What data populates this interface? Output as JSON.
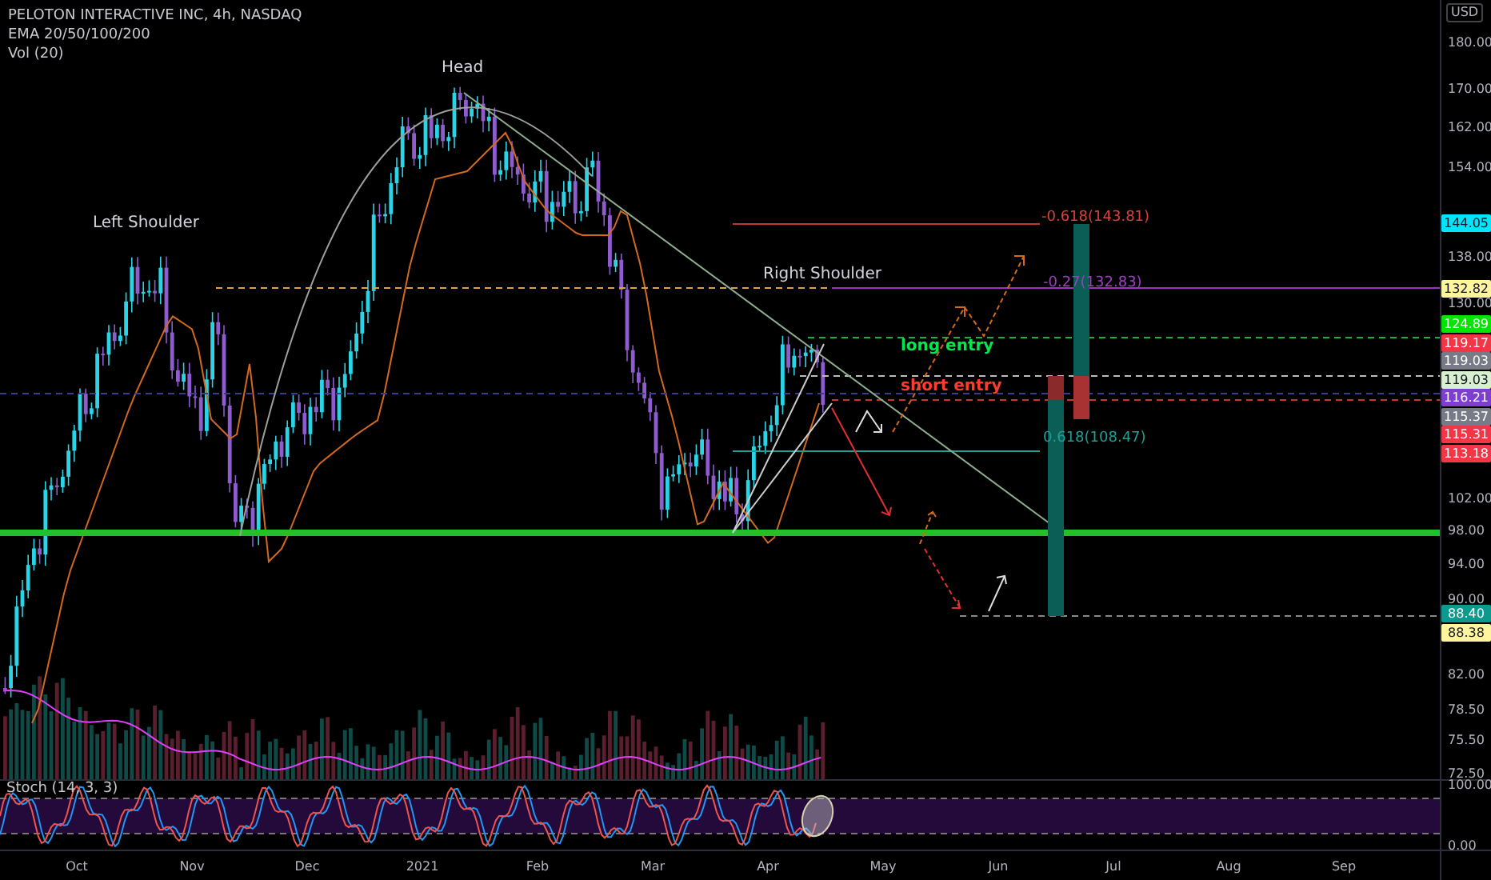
{
  "header": {
    "symbol": "PELOTON INTERACTIVE INC, 4h, NASDAQ",
    "indicators": [
      "EMA 20/50/100/200",
      "Vol (20)"
    ]
  },
  "annotations": [
    {
      "kind": "pattern",
      "text": "Head",
      "color": "#d1d4dc"
    },
    {
      "kind": "pattern",
      "text": "Left Shoulder",
      "color": "#d1d4dc"
    },
    {
      "kind": "pattern",
      "text": "Right Shoulder",
      "color": "#d1d4dc"
    },
    {
      "kind": "entry",
      "text": "long entry",
      "color": "#00e64d"
    },
    {
      "kind": "entry",
      "text": "short entry",
      "color": "#ff3b30"
    },
    {
      "kind": "fib",
      "text": "-0.618(143.81)",
      "color": "#d9413a"
    },
    {
      "kind": "fib",
      "text": "-0.27(132.83)",
      "color": "#9c3fc0"
    },
    {
      "kind": "fib",
      "text": "0.618(108.47)",
      "color": "#1f9e94"
    }
  ],
  "price_axis": {
    "currency": "USD",
    "ticks": [
      "180.00",
      "170.00",
      "162.00",
      "154.00",
      "138.00",
      "130.00",
      "102.00",
      "98.00",
      "94.00",
      "90.00",
      "82.00",
      "78.50",
      "75.50",
      "72.50"
    ],
    "badges": [
      {
        "text": "144.05",
        "color": "#00e5ff"
      },
      {
        "text": "132.82",
        "color": "#fff59d"
      },
      {
        "text": "124.89",
        "color": "#00e600"
      },
      {
        "text": "119.17",
        "color": "#f23645"
      },
      {
        "text": "119.03",
        "color": "#787b86"
      },
      {
        "text": "119.03",
        "color": "#d8f0d0"
      },
      {
        "text": "116.21",
        "color": "#7e3fd0"
      },
      {
        "text": "115.37",
        "color": "#787b86"
      },
      {
        "text": "115.31",
        "color": "#f23645"
      },
      {
        "text": "113.18",
        "color": "#f23645"
      },
      {
        "text": "88.40",
        "color": "#0b9a8e"
      },
      {
        "text": "88.38",
        "color": "#fff59d"
      }
    ]
  },
  "stoch": {
    "label": "Stoch (14, 3, 3)",
    "ticks": [
      "100.00",
      "0.00"
    ]
  },
  "time_axis": {
    "labels": [
      "Oct",
      "Nov",
      "Dec",
      "2021",
      "Feb",
      "Mar",
      "Apr",
      "May",
      "Jun",
      "Jul",
      "Aug",
      "Sep"
    ]
  }
}
